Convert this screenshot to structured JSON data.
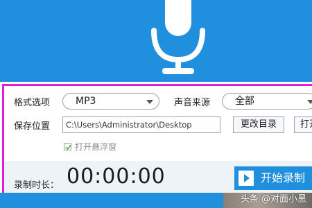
{
  "format": {
    "label": "格式选项",
    "value": "MP3"
  },
  "source": {
    "label": "声音来源",
    "value": "全部"
  },
  "save": {
    "label": "保存位置",
    "path": "C:\\Users\\Administrator\\Desktop",
    "change_dir_label": "更改目录",
    "open_label": "打开"
  },
  "floating_window": {
    "label": "打开悬浮窗",
    "checked": true
  },
  "recording": {
    "time_label": "录制时长：",
    "time_value": "00:00:00",
    "start_label": "开始录制"
  },
  "watermark": "头条 @对面小黑",
  "colors": {
    "brand": "#1f8fde",
    "highlight": "#e020d8"
  }
}
